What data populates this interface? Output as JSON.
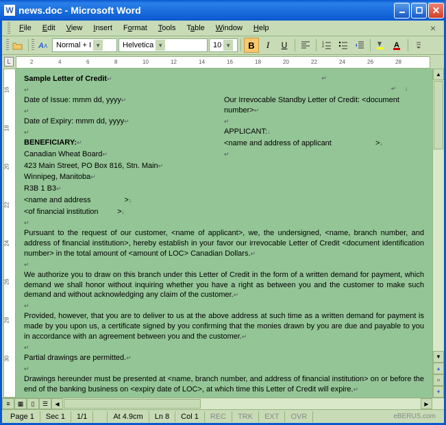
{
  "window": {
    "title": "news.doc - Microsoft Word",
    "app_icon": "W"
  },
  "menus": {
    "file": "File",
    "edit": "Edit",
    "view": "View",
    "insert": "Insert",
    "format": "Format",
    "tools": "Tools",
    "table": "Table",
    "window": "Window",
    "help": "Help"
  },
  "toolbar": {
    "style": "Normal + I",
    "font": "Helvetica",
    "size": "10"
  },
  "ruler": {
    "numbers": [
      2,
      4,
      6,
      8,
      10,
      12,
      14,
      16,
      18,
      20,
      22,
      24,
      26,
      28
    ]
  },
  "vruler": {
    "numbers": [
      16,
      18,
      20,
      22,
      24,
      26,
      28,
      30
    ]
  },
  "doc": {
    "title": "Sample Letter of Credit",
    "date_issue": "Date of Issue: mmm dd, yyyy",
    "date_expiry": "Date of Expiry: mmm dd, yyyy",
    "right_loc": "Our Irrevocable Standby Letter of Credit: <document number>",
    "applicant_h": "APPLICANT:",
    "applicant_v": "<name and address of applicant",
    "beneficiary_h": "BENEFICIARY:",
    "ben_1": "Canadian Wheat Board",
    "ben_2": "423 Main Street, PO Box 816, Stn. Main",
    "ben_3": "Winnipeg, Manitoba",
    "ben_4": "R3B 1 B3",
    "ben_5": "<name and address",
    "ben_6": "<of financial institution",
    "gt": ">",
    "p1": "Pursuant to the request of our customer, <name of applicant>, we, the undersigned, <name, branch number, and address of financial institution>, hereby establish in your favor our irrevocable Letter of Credit <document identification number> in the total amount of <amount of LOC> Canadian Dollars.",
    "p2": "We authorize you to draw on this branch under this Letter of Credit in the form of a written demand for payment, which demand we shall honor without inquiring whether you have a right as between you and the customer to make such demand and without acknowledging any claim of the customer.",
    "p3": "Provided, however, that you are to deliver to us at the above address at such time as a written demand for payment is made by you upon us, a certificate signed by you confirming that the monies drawn by you are due and payable to you in accordance with an agreement between you and the customer.",
    "p4": "Partial drawings are permitted.",
    "p5": "Drawings hereunder must be presented at <name, branch number, and address of financial institution> on or before the end of the banking business on <expiry date of LOC>, at which time this Letter of Credit will expire."
  },
  "status": {
    "page": "Page 1",
    "sec": "Sec 1",
    "pages": "1/1",
    "at": "At 4.9cm",
    "ln": "Ln 8",
    "col": "Col 1",
    "rec": "REC",
    "trk": "TRK",
    "ext": "EXT",
    "ovr": "OVR",
    "watermark": "eBERUS.com"
  }
}
